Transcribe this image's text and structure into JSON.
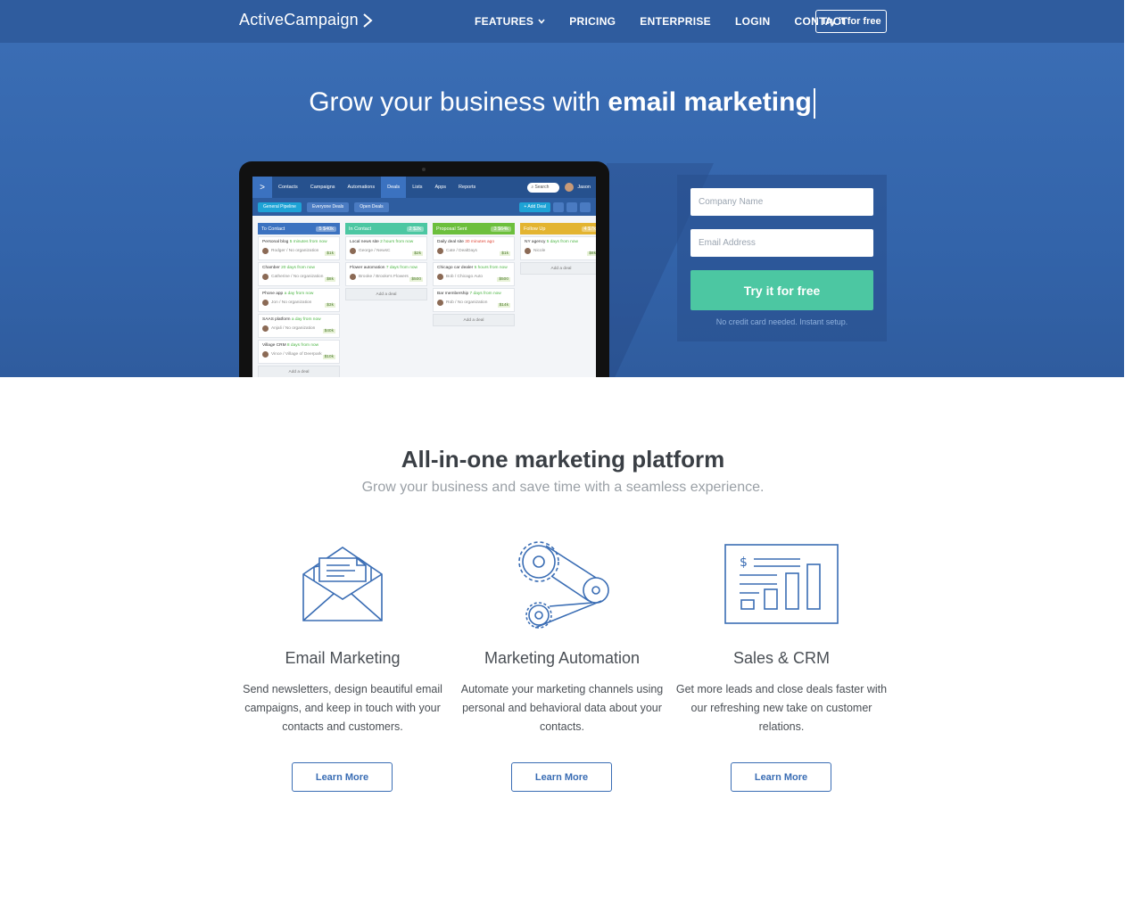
{
  "brand": {
    "name": "ActiveCampaign"
  },
  "nav": {
    "items": [
      "FEATURES",
      "PRICING",
      "ENTERPRISE",
      "LOGIN",
      "CONTACT"
    ],
    "cta": "Try it for free"
  },
  "hero": {
    "title_prefix": "Grow your business with ",
    "title_highlight": "email marketing"
  },
  "app": {
    "nav": [
      "Contacts",
      "Campaigns",
      "Automations",
      "Deals",
      "Lists",
      "Apps",
      "Reports"
    ],
    "search": "Search",
    "user": "Jason",
    "toolbar": [
      "General Pipeline",
      "Everyone Deals",
      "Open Deals"
    ],
    "add_deal": "+ Add Deal",
    "add_deal_card": "Add a deal",
    "columns": [
      {
        "name": "To Contact",
        "color": "#3b72c0",
        "count": "5",
        "amount": "$40k",
        "cards": [
          {
            "title": "Personal blog",
            "when": "5 minutes from now",
            "person": "Rodger / No organization",
            "amount": "$1k"
          },
          {
            "title": "Chamber",
            "when": "20 days from now",
            "person": "Catherine / No organization",
            "amount": "$8k"
          },
          {
            "title": "Phone app",
            "when": "a day from now",
            "person": "Jon / No organization",
            "amount": "$3k"
          },
          {
            "title": "SAAS platform",
            "when": "a day from now",
            "person": "Anjali / No organization",
            "amount": "$40k"
          },
          {
            "title": "Village CRM",
            "when": "8 days from now",
            "person": "Vince / Village of Deerpark",
            "amount": "$10k"
          }
        ]
      },
      {
        "name": "In Contact",
        "color": "#4cc7a2",
        "count": "2",
        "amount": "$2k",
        "cards": [
          {
            "title": "Local news site",
            "when": "2 hours from now",
            "person": "George / NewsC",
            "amount": "$2k"
          },
          {
            "title": "Flower automation",
            "when": "7 days from now",
            "person": "Brooke / Brooke's Flowers",
            "amount": "$500"
          }
        ]
      },
      {
        "name": "Proposal Sent",
        "color": "#6cbf3c",
        "count": "3",
        "amount": "$64k",
        "cards": [
          {
            "title": "Daily deal site",
            "when": "30 minutes ago",
            "person": "Cate / DealDays",
            "amount": "$1k",
            "late": true
          },
          {
            "title": "Chicago car dealer",
            "when": "5 hours from now",
            "person": "Bob / Chicago Auto",
            "amount": "$500"
          },
          {
            "title": "Bar membership",
            "when": "7 days from now",
            "person": "Rob / No organization",
            "amount": "$14k"
          }
        ]
      },
      {
        "name": "Follow Up",
        "color": "#e3b431",
        "count": "4",
        "amount": "$7k",
        "cards": [
          {
            "title": "NY agency",
            "when": "5 days from now",
            "person": "Nicole",
            "amount": "$8k"
          }
        ]
      }
    ]
  },
  "signup": {
    "company_placeholder": "Company Name",
    "email_placeholder": "Email Address",
    "button": "Try it for free",
    "note": "No credit card needed. Instant setup."
  },
  "platform": {
    "title": "All-in-one marketing platform",
    "subtitle": "Grow your business and save time with a seamless experience.",
    "features": [
      {
        "icon": "envelope-icon",
        "title": "Email Marketing",
        "desc": "Send newsletters, design beautiful email campaigns, and keep in touch with your contacts and customers.",
        "button": "Learn More"
      },
      {
        "icon": "gears-icon",
        "title": "Marketing Automation",
        "desc": "Automate your marketing channels using personal and behavioral data about your contacts.",
        "button": "Learn More"
      },
      {
        "icon": "sales-chart-icon",
        "title": "Sales & CRM",
        "desc": "Get more leads and close deals faster with our refreshing new take on customer relations.",
        "button": "Learn More"
      }
    ]
  },
  "colors": {
    "nav": "#2f5c9e",
    "hero": "#3a6db4",
    "cta": "#4cc7a2",
    "link": "#3a6db4"
  }
}
